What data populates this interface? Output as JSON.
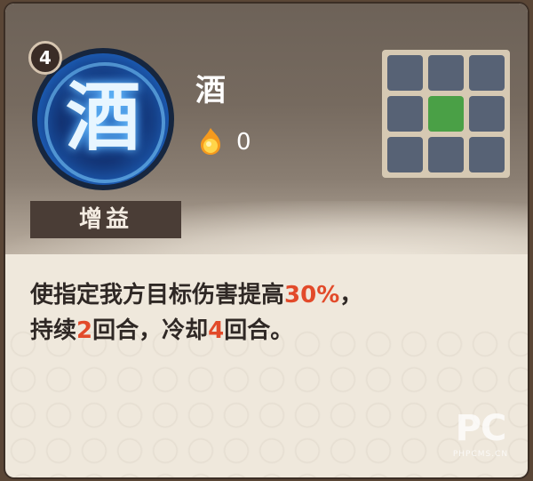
{
  "skill": {
    "level": "4",
    "icon_glyph": "酒",
    "name": "酒",
    "cost_icon": "fire-orb-icon",
    "cost": "0",
    "tag": "增益"
  },
  "range_grid": {
    "rows": 3,
    "cols": 3,
    "active_cells": [
      [
        1,
        1
      ]
    ],
    "active_color": "#4aa046",
    "inactive_color": "#576275"
  },
  "description": {
    "line1_prefix": "使指定我方目标伤害提高",
    "line1_value": "30%",
    "line1_suffix": "，",
    "line2_a": "持续",
    "line2_value1": "2",
    "line2_b": "回合，冷却",
    "line2_value2": "4",
    "line2_c": "回合。",
    "highlight_color": "#e24a2a"
  },
  "watermark": {
    "logo": "PC",
    "site": "PHPCMS.CN"
  }
}
